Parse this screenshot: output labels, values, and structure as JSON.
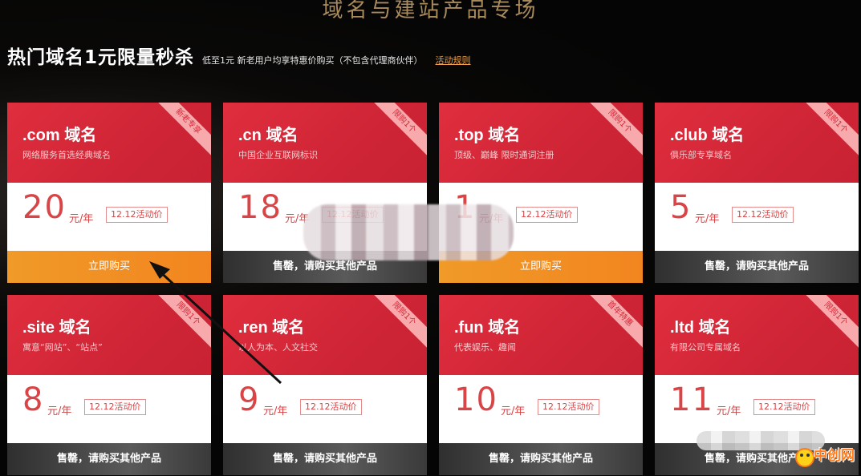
{
  "page": {
    "top_title": "域名与建站产品专场",
    "header_title": "热门域名1元限量秒杀",
    "header_sub": "低至1元 新老用户均享特惠价购买（不包含代理商伙伴）",
    "header_rules": "活动规则"
  },
  "unit": "元/年",
  "cards": [
    {
      "title": ".com 域名",
      "desc": "网络服务首选经典域名",
      "badge": "新老专享",
      "price": "20",
      "promo": "12.12活动价",
      "button": "立即购买",
      "button_state": "buy"
    },
    {
      "title": ".cn 域名",
      "desc": "中国企业互联网标识",
      "badge": "限购1个",
      "price": "18",
      "promo": "12.12活动价",
      "button": "售罄，请购买其他产品",
      "button_state": "sold"
    },
    {
      "title": ".top 域名",
      "desc": "顶级、巅峰 限时通词注册",
      "badge": "限购1个",
      "price": "1",
      "promo": "12.12活动价",
      "button": "立即购买",
      "button_state": "buy"
    },
    {
      "title": ".club 域名",
      "desc": "俱乐部专享域名",
      "badge": "限购1个",
      "price": "5",
      "promo": "12.12活动价",
      "button": "售罄，请购买其他产品",
      "button_state": "sold"
    },
    {
      "title": ".site 域名",
      "desc": "寓意“网站”、“站点”",
      "badge": "限购1个",
      "price": "8",
      "promo": "12.12活动价",
      "button": "售罄，请购买其他产品",
      "button_state": "sold"
    },
    {
      "title": ".ren 域名",
      "desc": "以人为本、人文社交",
      "badge": "限购1个",
      "price": "9",
      "promo": "12.12活动价",
      "button": "售罄，请购买其他产品",
      "button_state": "sold"
    },
    {
      "title": ".fun 域名",
      "desc": "代表娱乐、趣闻",
      "badge": "首年特惠",
      "price": "10",
      "promo": "12.12活动价",
      "button": "售罄，请购买其他产品",
      "button_state": "sold"
    },
    {
      "title": ".ltd 域名",
      "desc": "有限公司专属域名",
      "badge": "限购1个",
      "price": "11",
      "promo": "12.12活动价",
      "button": "售罄，请购买其他产品",
      "button_state": "sold"
    }
  ],
  "watermark": "中创网",
  "colors": {
    "card_red": "#d72a3a",
    "buy_orange": "#f2901f",
    "sold_gray": "#444444",
    "price_red": "#d94446"
  }
}
